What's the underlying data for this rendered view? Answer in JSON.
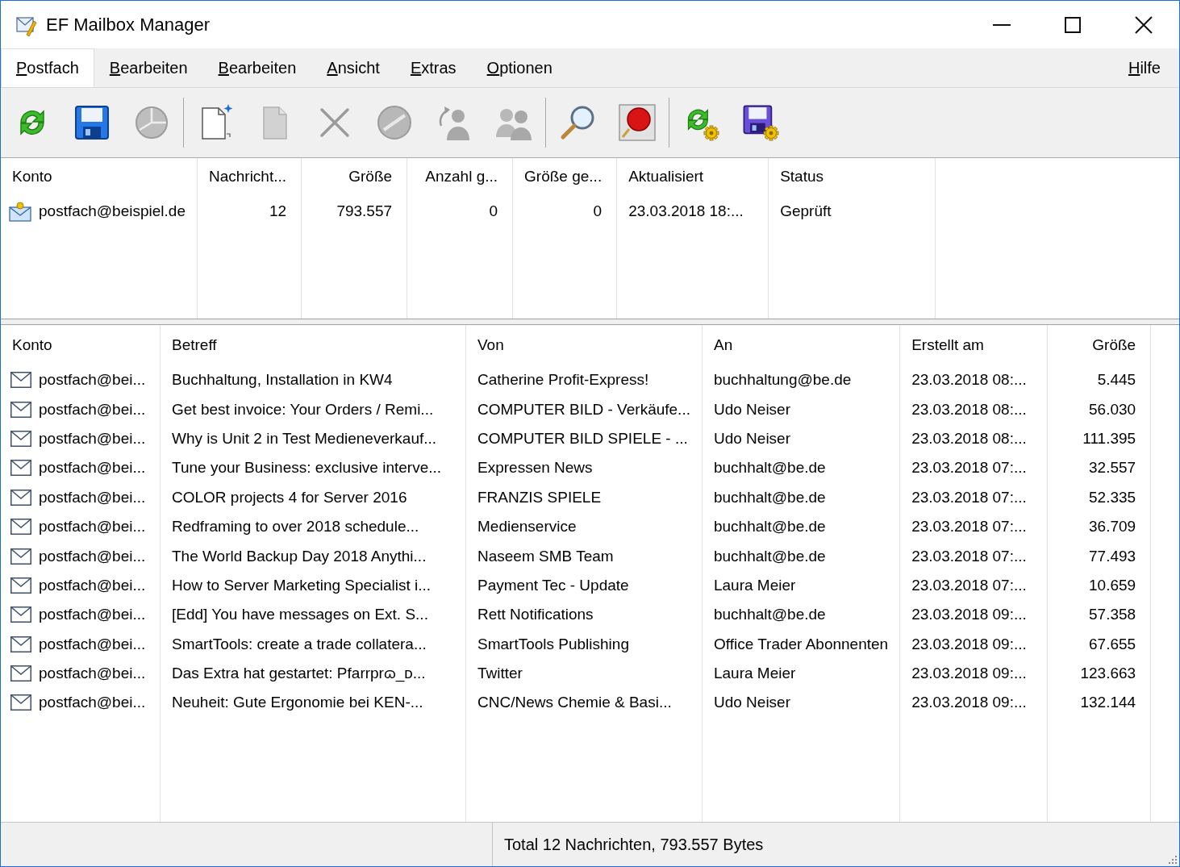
{
  "window": {
    "title": "EF Mailbox Manager"
  },
  "menu": {
    "items": [
      {
        "label": "Postfach",
        "selected": true
      },
      {
        "label": "Bearbeiten",
        "selected": false
      },
      {
        "label": "Bearbeiten",
        "selected": false
      },
      {
        "label": "Ansicht",
        "selected": false
      },
      {
        "label": "Extras",
        "selected": false
      },
      {
        "label": "Optionen",
        "selected": false
      }
    ],
    "help": {
      "label": "Hilfe",
      "selected": false
    }
  },
  "toolbar": {
    "groups": [
      [
        {
          "kind": "refresh",
          "disabled": false
        },
        {
          "kind": "save",
          "disabled": false
        },
        {
          "kind": "chart",
          "disabled": true
        }
      ],
      [
        {
          "kind": "new-document",
          "disabled": false
        },
        {
          "kind": "document",
          "disabled": true
        },
        {
          "kind": "delete",
          "disabled": true
        },
        {
          "kind": "block",
          "disabled": true
        },
        {
          "kind": "add-user",
          "disabled": true
        },
        {
          "kind": "users",
          "disabled": true
        }
      ],
      [
        {
          "kind": "search",
          "disabled": false
        },
        {
          "kind": "pin",
          "disabled": false
        }
      ],
      [
        {
          "kind": "sync-settings",
          "disabled": false
        },
        {
          "kind": "save-settings",
          "disabled": false
        }
      ]
    ]
  },
  "accounts": {
    "columns": [
      "Konto",
      "Nachricht...",
      "Größe",
      "Anzahl g...",
      "Größe ge...",
      "Aktualisiert",
      "Status"
    ],
    "rows": [
      [
        "postfach@beispiel.de",
        "12",
        "793.557",
        "0",
        "0",
        "23.03.2018 18:...",
        "Geprüft"
      ]
    ]
  },
  "messages": {
    "columns": [
      "Konto",
      "Betreff",
      "Von",
      "An",
      "Erstellt am",
      "Größe"
    ],
    "rows": [
      [
        "postfach@bei...",
        "Buchhaltung, Installation in KW4",
        "Catherine Profit-Express!",
        "buchhaltung@be.de",
        "23.03.2018 08:...",
        "5.445"
      ],
      [
        "postfach@bei...",
        "Get best invoice: Your Orders / Remi...",
        "COMPUTER BILD - Verkäufe...",
        "Udo Neiser",
        "23.03.2018 08:...",
        "56.030"
      ],
      [
        "postfach@bei...",
        "Why is Unit 2 in Test Medieneverkauf...",
        "COMPUTER BILD SPIELE - ...",
        "Udo Neiser",
        "23.03.2018 08:...",
        "111.395"
      ],
      [
        "postfach@bei...",
        "Tune your Business: exclusive interve...",
        "Expressen News",
        "buchhalt@be.de",
        "23.03.2018 07:...",
        "32.557"
      ],
      [
        "postfach@bei...",
        "COLOR projects 4 for Server 2016",
        "FRANZIS SPIELE",
        "buchhalt@be.de",
        "23.03.2018 07:...",
        "52.335"
      ],
      [
        "postfach@bei...",
        "Redframing to over 2018 schedule...",
        "Medienservice",
        "buchhalt@be.de",
        "23.03.2018 07:...",
        "36.709"
      ],
      [
        "postfach@bei...",
        "The World Backup Day 2018 Anythi...",
        "Naseem SMB Team",
        "buchhalt@be.de",
        "23.03.2018 07:...",
        "77.493"
      ],
      [
        "postfach@bei...",
        "How to Server Marketing Specialist i...",
        "Payment Tec - Update",
        "Laura Meier",
        "23.03.2018 07:...",
        "10.659"
      ],
      [
        "postfach@bei...",
        "[Edd] You have messages on Ext. S...",
        "Rett Notifications",
        "buchhalt@be.de",
        "23.03.2018 09:...",
        "57.358"
      ],
      [
        "postfach@bei...",
        "SmartTools: create a trade collatera...",
        "SmartTools Publishing",
        "Office Trader Abonnenten",
        "23.03.2018 09:...",
        "67.655"
      ],
      [
        "postfach@bei...",
        "Das Extra hat gestartet: Pfarrprɷ_ᴅ...",
        "Twitter",
        "Laura Meier",
        "23.03.2018 09:...",
        "123.663"
      ],
      [
        "postfach@bei...",
        "Neuheit: Gute Ergonomie bei KEN-...",
        "CNC/News Chemie & Basi...",
        "Udo Neiser",
        "23.03.2018 09:...",
        "132.144"
      ]
    ]
  },
  "status_bar": {
    "text": "Total 12 Nachrichten, 793.557 Bytes"
  }
}
